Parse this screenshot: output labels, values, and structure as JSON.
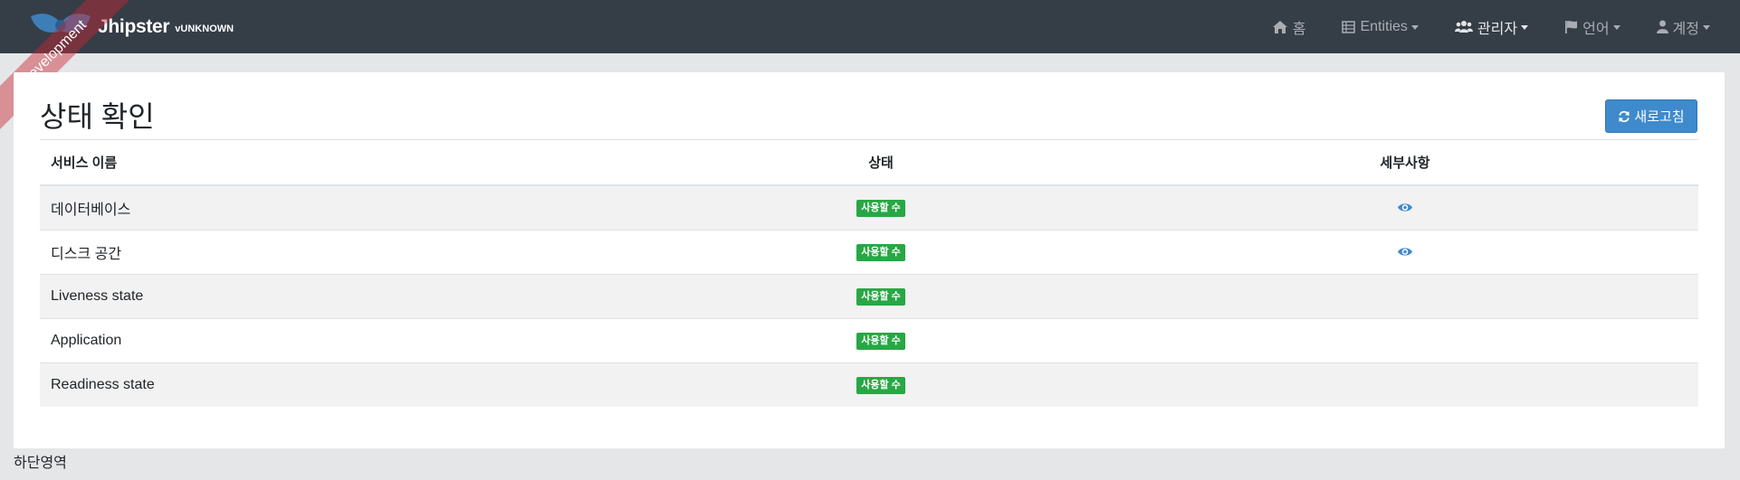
{
  "brand": {
    "name": "Jhipster",
    "version": "vUNKNOWN"
  },
  "ribbon": "Development",
  "nav": [
    {
      "label": "홈",
      "icon": "home-icon"
    },
    {
      "label": "Entities",
      "icon": "table-icon"
    },
    {
      "label": "관리자",
      "icon": "users-icon"
    },
    {
      "label": "언어",
      "icon": "flag-icon"
    },
    {
      "label": "계정",
      "icon": "user-icon"
    }
  ],
  "page": {
    "title": "상태 확인",
    "refresh_label": "새로고침"
  },
  "table": {
    "headers": {
      "name": "서비스 이름",
      "status": "상태",
      "details": "세부사항"
    },
    "rows": [
      {
        "name": "데이터베이스",
        "status": "사용할 수",
        "has_details": true
      },
      {
        "name": "디스크 공간",
        "status": "사용할 수",
        "has_details": true
      },
      {
        "name": "Liveness state",
        "status": "사용할 수",
        "has_details": false
      },
      {
        "name": "Application",
        "status": "사용할 수",
        "has_details": false
      },
      {
        "name": "Readiness state",
        "status": "사용할 수",
        "has_details": false
      }
    ]
  },
  "footer": "하단영역",
  "colors": {
    "navbar": "#353d47",
    "accent": "#3e8acc",
    "badge": "#28a745",
    "ribbon": "#c82832"
  }
}
